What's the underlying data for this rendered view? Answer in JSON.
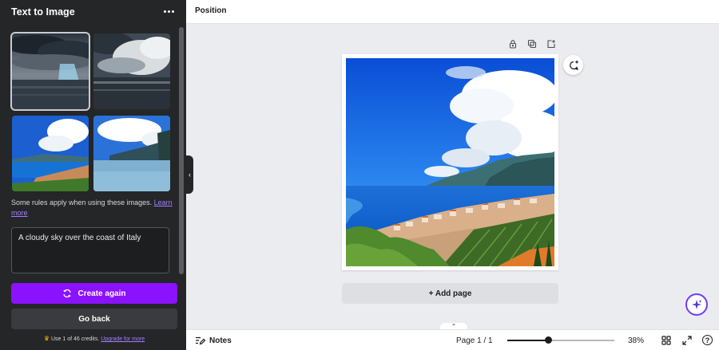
{
  "panel": {
    "title": "Text to Image",
    "rules_text": "Some rules apply when using these images.",
    "rules_link": "Learn more",
    "prompt": "A cloudy sky over the coast of Italy",
    "create_label": "Create again",
    "back_label": "Go back",
    "credits_text": "Use 1 of 46 credits.",
    "credits_link": "Upgrade for more",
    "thumbnails": [
      "stormy-sea",
      "clouds-over-sea",
      "coast-village",
      "coast-bay"
    ],
    "selected_thumbnail": 0
  },
  "topbar": {
    "position_label": "Position"
  },
  "canvas": {
    "add_page_label": "+ Add page"
  },
  "bottombar": {
    "notes_label": "Notes",
    "page_indicator": "Page 1 / 1",
    "zoom_value": "38%",
    "zoom_fraction": 0.38,
    "help_label": "?"
  },
  "colors": {
    "accent": "#8b12ff",
    "panel_bg": "#252627",
    "link": "#a47dff"
  }
}
